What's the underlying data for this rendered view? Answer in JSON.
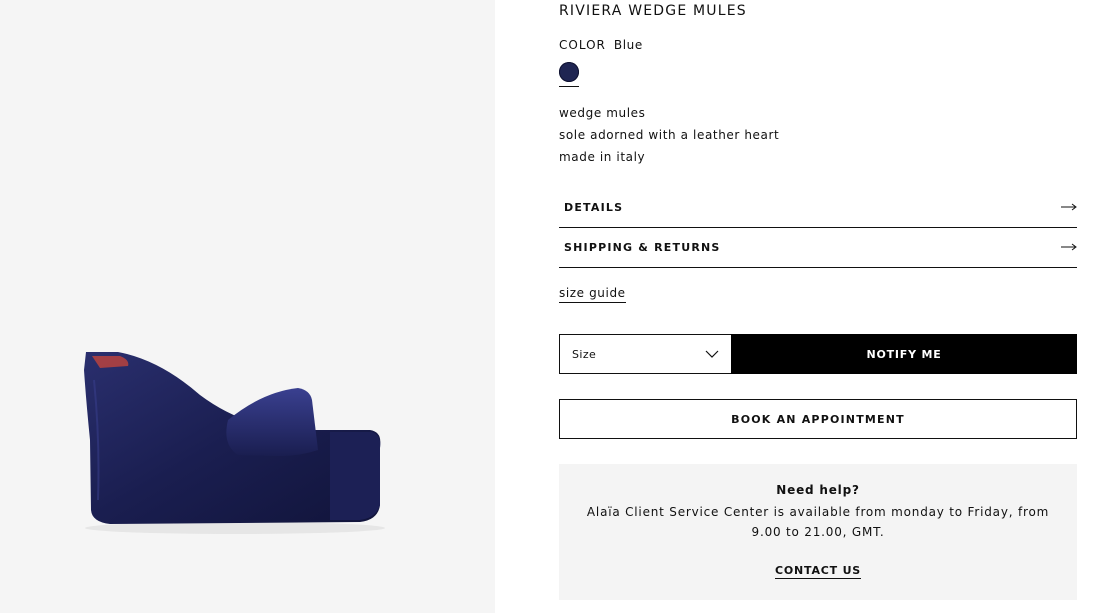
{
  "product": {
    "title": "RIVIERA WEDGE MULES",
    "image_alt": "navy velvet wedge mule"
  },
  "color": {
    "label": "COLOR",
    "value": "Blue",
    "swatch_hex": "#1f2552"
  },
  "description": [
    "wedge mules",
    "sole adorned with a leather heart",
    "made in italy"
  ],
  "accordions": {
    "details": "DETAILS",
    "shipping": "SHIPPING & RETURNS"
  },
  "size_guide": "size guide",
  "size_select": {
    "selected": "Size"
  },
  "buttons": {
    "notify": "NOTIFY ME",
    "appointment": "BOOK AN APPOINTMENT"
  },
  "help": {
    "title": "Need help?",
    "text": "Alaïa Client Service Center is available from monday to Friday, from 9.00 to 21.00, GMT.",
    "link": "CONTACT US"
  },
  "icons": {
    "accordion_arrow": "long-arrow-right-icon",
    "select_chevron": "chevron-down-icon"
  },
  "colors": {
    "accent_black": "#000000",
    "help_bg": "#f4f4f4",
    "media_bg": "#f5f5f5"
  }
}
